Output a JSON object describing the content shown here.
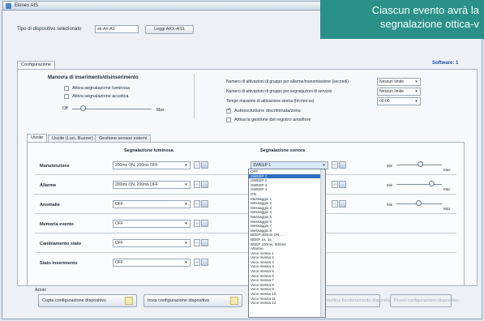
{
  "window": {
    "title": "Ekinex AIS"
  },
  "banner": {
    "line1": "Ciascun evento avrà la",
    "line2": "segnalazione ottica-v"
  },
  "device_type": {
    "label": "Tipo di dispositivo selezionato",
    "value": "ek-AX-AS",
    "button": "Leggi AKX-AS1"
  },
  "tabs_main": {
    "configurazione": "Configurazione"
  },
  "software_label": "Software: 1",
  "illumination": {
    "title": "Manovra di inserimento/disinserimento",
    "opt1": "Attiva segnalazione luminosa",
    "opt2": "Attiva segnalazione acustica",
    "level_low": "Off",
    "level_high": "Max"
  },
  "params": {
    "p1": {
      "label": "Numero di attivazioni di gruppo per allarme/manomissione (secondi)",
      "value": "Nessun limite"
    },
    "p2": {
      "label": "Numero di attivazioni di gruppo per segnalazioni di servizio",
      "value": "Nessun limite"
    },
    "p3": {
      "label": "Tempo massimo di attivazione sirena (hh:mm:ss)",
      "value": "00:00"
    },
    "c1": "Autoesclusione discriminata/zona",
    "c2": "Attiva la gestione del registro antisfiore"
  },
  "subtabs": {
    "t1": "Uscite",
    "t2": "Uscite (Luci, Buzzer)",
    "t3": "Gestione sensori esterni"
  },
  "headers": {
    "luminous": "Segnalazione luminosa",
    "acoustic": "Segnalazione sonora"
  },
  "rows": [
    {
      "label": "Manutenzione",
      "luminous": "200ms ON, 200ms OFF",
      "acoustic": "SWEEP 1",
      "min": "Min",
      "max": "Max"
    },
    {
      "label": "Allarme",
      "luminous": "200ms ON, 200ms OFF",
      "acoustic": "",
      "min": "Min",
      "max": "Max"
    },
    {
      "label": "Anomalie",
      "luminous": "OFF",
      "acoustic": "",
      "min": "Min",
      "max": "Max"
    },
    {
      "label": "Memoria evento",
      "luminous": "OFF"
    },
    {
      "label": "Cambiamento stato",
      "luminous": "OFF"
    },
    {
      "label": "Stato inserimento",
      "luminous": "OFF"
    }
  ],
  "dropdown_options": [
    "OFF",
    "SWEEP 1",
    "SWEEP 2",
    "SWEEP 3",
    "SWEEP 4",
    "ON",
    "Messaggio 1",
    "Messaggio 2",
    "Messaggio 3",
    "Messaggio 4",
    "Messaggio 5",
    "Messaggio 6",
    "Messaggio 7",
    "Messaggio 8",
    "BEEP 400ms ON, ...",
    "BEEP 1s, 1s",
    "BEEP 100ms, 900ms",
    "Allarme",
    "Voce messa 1",
    "Voce messa 2",
    "Voce messa 3",
    "Voce messa 4",
    "Voce messa 5",
    "Voce messa 6",
    "Voce messa 7",
    "Voce messa 8",
    "Voce messa 9",
    "Voce messa 10",
    "Voce messa 11",
    "Voce messa 12"
  ],
  "bottom": {
    "group_label": "Azioni",
    "b1": "Copia configurazione dispositivo",
    "b2": "Invia configurazione dispositivo",
    "b3": "Verifica funzionamento dispositivo",
    "b4": "Ricevi configurazione dispositivo"
  }
}
